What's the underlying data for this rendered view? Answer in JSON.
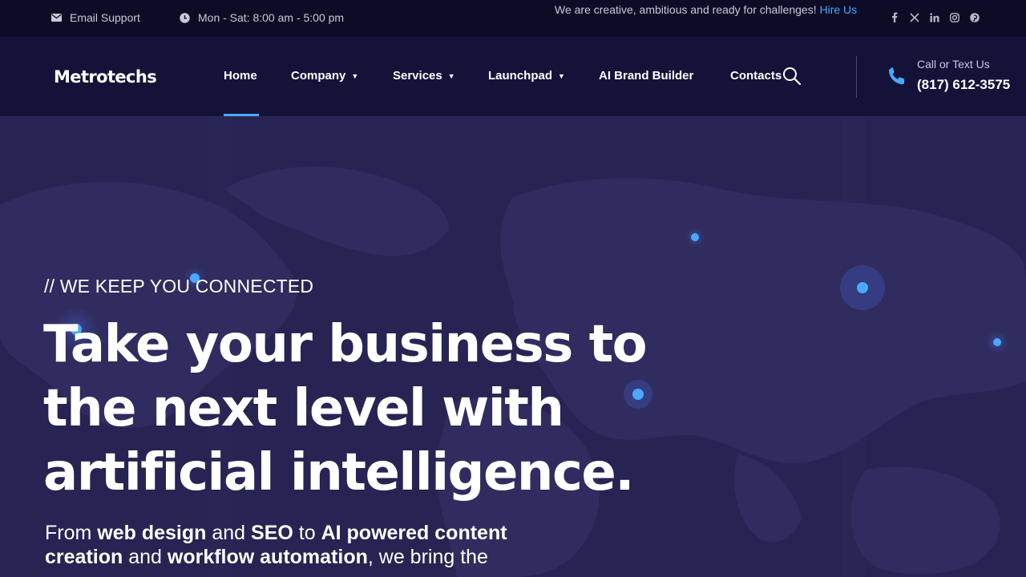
{
  "topbar": {
    "email_label": "Email Support",
    "hours_label": "Mon - Sat: 8:00 am - 5:00 pm",
    "tagline": "We are creative, ambitious and ready for challenges!",
    "hire_link": "Hire Us",
    "social_icons": [
      "facebook-icon",
      "x-icon",
      "linkedin-icon",
      "instagram-icon",
      "pinterest-icon"
    ]
  },
  "header": {
    "logo": "Metrotechs",
    "nav": [
      {
        "label": "Home",
        "dropdown": false,
        "active": true
      },
      {
        "label": "Company",
        "dropdown": true
      },
      {
        "label": "Services",
        "dropdown": true
      },
      {
        "label": "Launchpad",
        "dropdown": true
      },
      {
        "label": "AI Brand Builder",
        "dropdown": false
      },
      {
        "label": "Contacts",
        "dropdown": false
      }
    ],
    "phone_label": "Call or Text Us",
    "phone_number": "(817) 612-3575"
  },
  "hero": {
    "eyebrow": "// WE KEEP YOU CONNECTED",
    "headline_lines": [
      "Take your business to",
      "the next level with",
      "artificial intelligence."
    ],
    "sub": [
      {
        "t": "From ",
        "b": false
      },
      {
        "t": "web design",
        "b": true
      },
      {
        "t": " and ",
        "b": false
      },
      {
        "t": "SEO",
        "b": true
      },
      {
        "t": " to ",
        "b": false
      },
      {
        "t": "AI powered content creation",
        "b": true
      },
      {
        "t": " and ",
        "b": false
      },
      {
        "t": "workflow automation",
        "b": true
      },
      {
        "t": ", we bring the",
        "b": false
      }
    ]
  },
  "colors": {
    "topbar_bg": "#0d0b26",
    "header_bg": "#15123a",
    "hero_bg": "#272352",
    "accent": "#49a8ff"
  }
}
